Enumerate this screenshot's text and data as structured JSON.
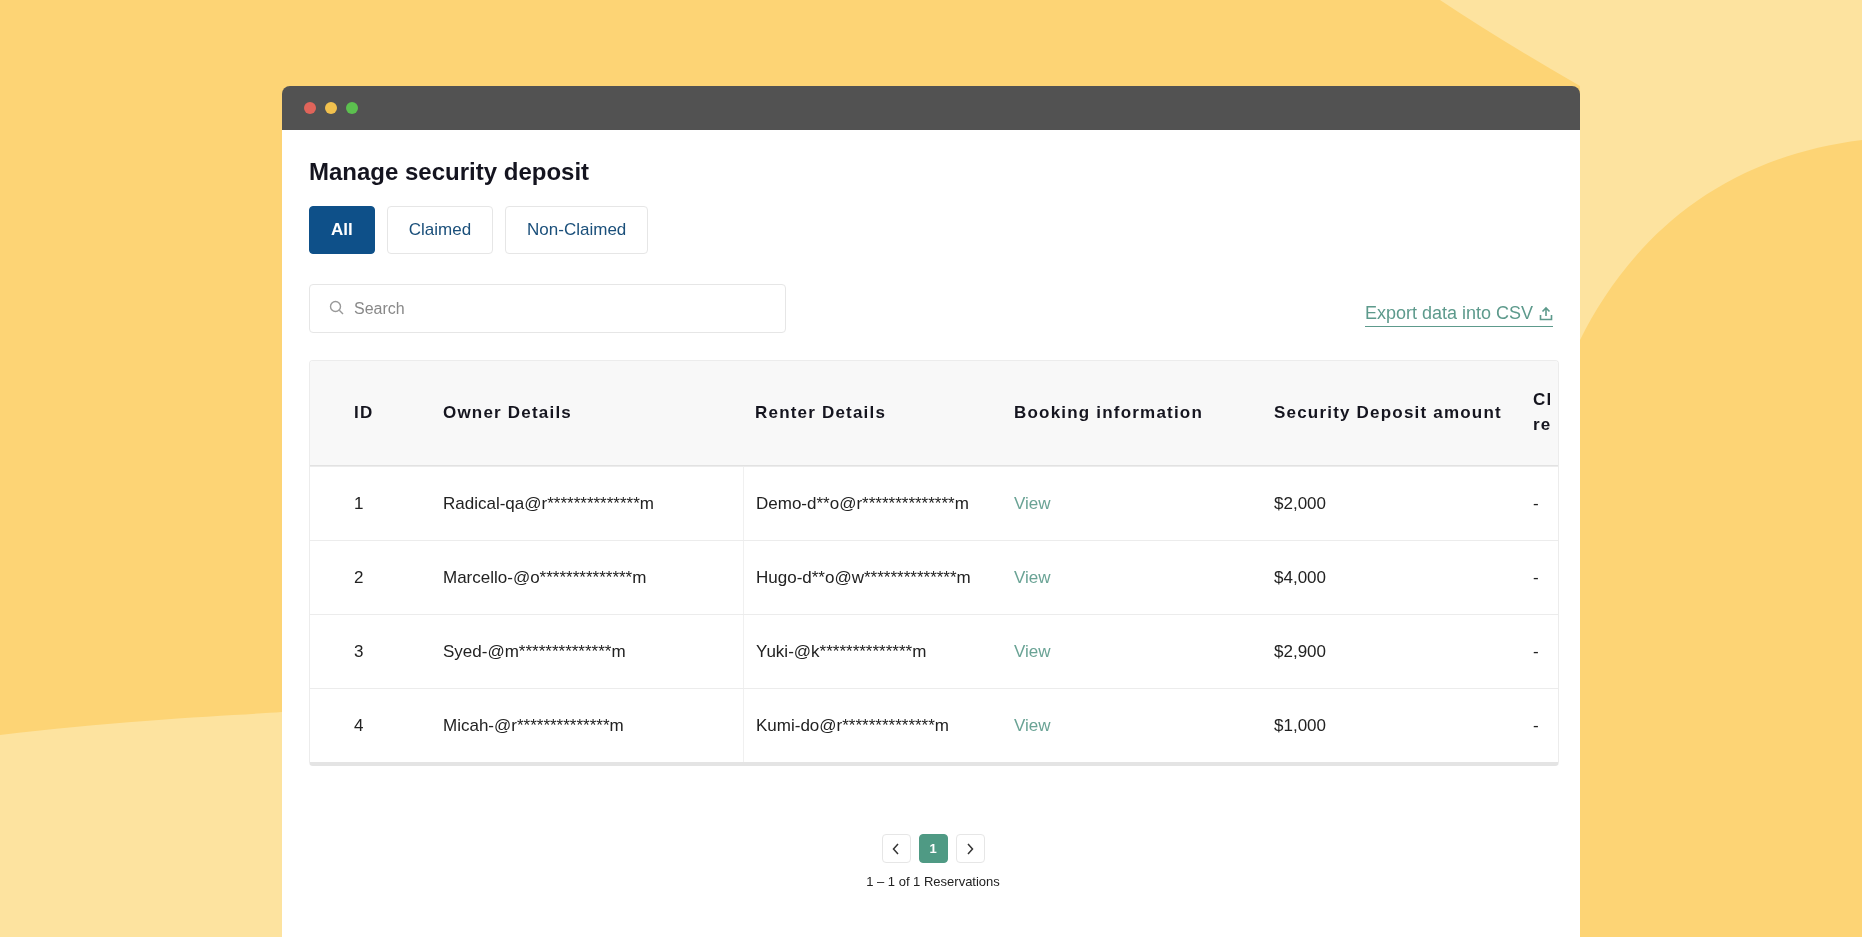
{
  "page": {
    "title": "Manage security deposit"
  },
  "tabs": [
    {
      "label": "All",
      "selected": true
    },
    {
      "label": "Claimed",
      "selected": false
    },
    {
      "label": "Non-Claimed",
      "selected": false
    }
  ],
  "search": {
    "placeholder": "Search"
  },
  "export_link": "Export data into CSV",
  "table": {
    "columns": [
      "ID",
      "Owner Details",
      "Renter Details",
      "Booking information",
      "Security Deposit amount",
      "Cl re"
    ],
    "rows": [
      {
        "id": "1",
        "owner": "Radical-qa@r**************m",
        "renter": "Demo-d**o@r**************m",
        "booking": "View",
        "amount": "$2,000",
        "column_6": "-"
      },
      {
        "id": "2",
        "owner": "Marcello-@o**************m",
        "renter": "Hugo-d**o@w**************m",
        "booking": "View",
        "amount": "$4,000",
        "column_6": "-"
      },
      {
        "id": "3",
        "owner": "Syed-@m**************m",
        "renter": "Yuki-@k**************m",
        "booking": "View",
        "amount": "$2,900",
        "column_6": "-"
      },
      {
        "id": "4",
        "owner": "Micah-@r**************m",
        "renter": "Kumi-do@r**************m",
        "booking": "View",
        "amount": "$1,000",
        "column_6": "-"
      }
    ]
  },
  "pagination": {
    "pages": [
      {
        "label": "1",
        "selected": true
      }
    ],
    "summary": "1 – 1 of 1 Reservations"
  }
}
